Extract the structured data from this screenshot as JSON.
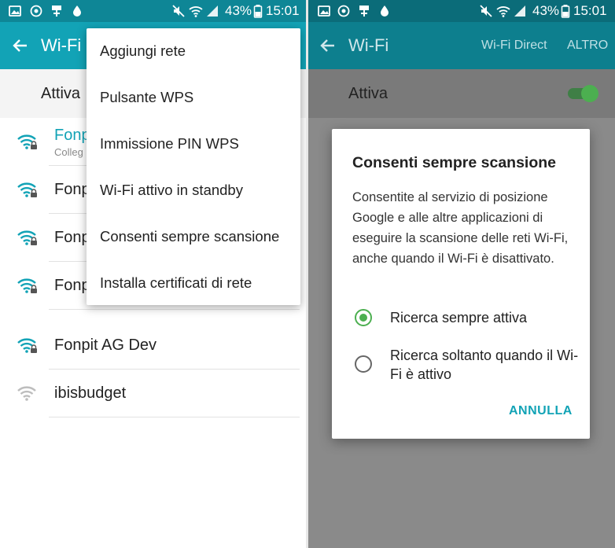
{
  "status_bar": {
    "battery": "43%",
    "time": "15:01"
  },
  "toolbar": {
    "title": "Wi-Fi",
    "wifi_direct": "Wi-Fi Direct",
    "more": "ALTRO"
  },
  "wifi_switch": {
    "label": "Attiva",
    "on": true
  },
  "networks": [
    {
      "name": "Fonpit",
      "status": "Colleg",
      "secured": true,
      "connected": true
    },
    {
      "name": "Fonp",
      "secured": true
    },
    {
      "name": "Fonp",
      "secured": true
    },
    {
      "name": "Fonp",
      "secured": true
    },
    {
      "name": "Fonpit AG Dev",
      "secured": true
    },
    {
      "name": "ibisbudget",
      "secured": false
    }
  ],
  "overflow_menu": [
    "Aggiungi rete",
    "Pulsante WPS",
    "Immissione PIN WPS",
    "Wi-Fi attivo in standby",
    "Consenti sempre scansione",
    "Installa certificati di rete"
  ],
  "dialog": {
    "title": "Consenti sempre scansione",
    "body": "Consentite al servizio di posizione Google e alle altre applicazioni di eseguire la scansione delle reti Wi-Fi, anche quando il Wi-Fi è disattivato.",
    "options": [
      {
        "label": "Ricerca sempre attiva",
        "selected": true
      },
      {
        "label": "Ricerca soltanto quando il Wi-Fi è attivo",
        "selected": false
      }
    ],
    "cancel": "ANNULLA"
  },
  "colors": {
    "accent": "#12a3b6",
    "status_bar": "#0e8696",
    "toggle_on": "#4caf50"
  },
  "icons": [
    "image-icon",
    "sync-icon",
    "usb-icon",
    "drop-icon",
    "mute-icon",
    "wifi-icon",
    "signal-icon",
    "battery-icon",
    "back-arrow-icon",
    "wifi-lock-icon"
  ]
}
